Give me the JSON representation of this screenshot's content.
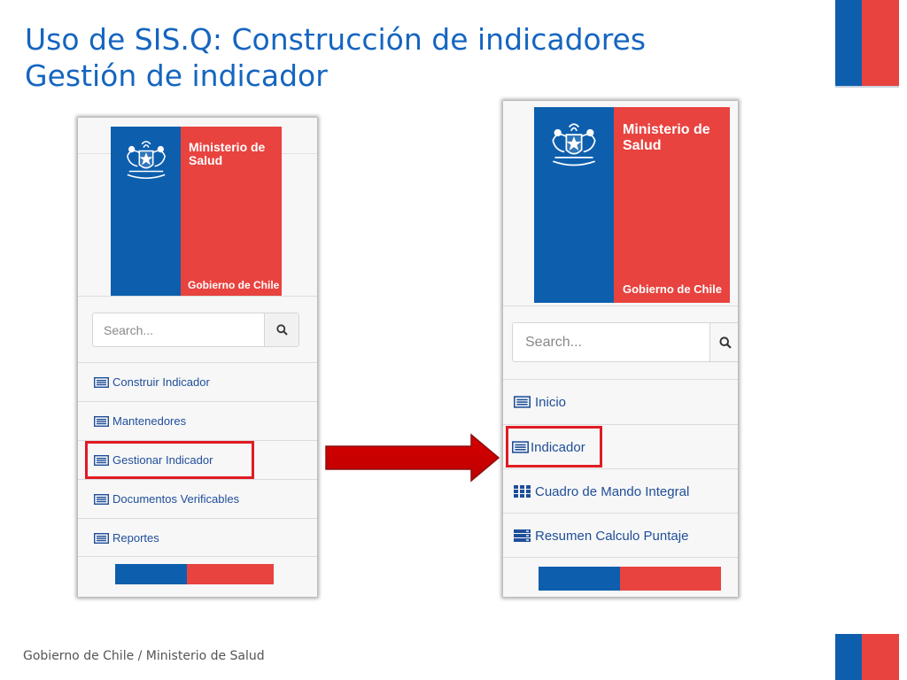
{
  "slide": {
    "title_line1": "Uso de SIS.Q: Construcción de indicadores",
    "title_line2": "Gestión de indicador",
    "footer": "Gobierno de Chile / Ministerio de Salud"
  },
  "colors": {
    "title": "#1565c0",
    "chile_blue": "#0d5fae",
    "chile_red": "#e8433f",
    "menu_link": "#1f4e99",
    "highlight_red": "#e01b24"
  },
  "logo": {
    "ministry": "Ministerio de Salud",
    "government": "Gobierno de Chile",
    "crest_icon": "chile-coat-of-arms-icon"
  },
  "left_panel": {
    "search": {
      "placeholder": "Search...",
      "icon": "search-icon"
    },
    "menu": [
      {
        "label": "Construir Indicador",
        "icon": "list-icon"
      },
      {
        "label": "Mantenedores",
        "icon": "list-icon"
      },
      {
        "label": "Gestionar Indicador",
        "icon": "list-icon",
        "highlighted": true
      },
      {
        "label": "Documentos Verificables",
        "icon": "list-icon"
      },
      {
        "label": "Reportes",
        "icon": "list-icon"
      }
    ]
  },
  "right_panel": {
    "search": {
      "placeholder": "Search...",
      "icon": "search-icon"
    },
    "menu": [
      {
        "label": "Inicio",
        "icon": "list-icon"
      },
      {
        "label": "Indicador",
        "icon": "list-icon",
        "highlighted": true
      },
      {
        "label": "Cuadro de Mando Integral",
        "icon": "grid-icon"
      },
      {
        "label": "Resumen Calculo Puntaje",
        "icon": "server-icon"
      }
    ]
  }
}
